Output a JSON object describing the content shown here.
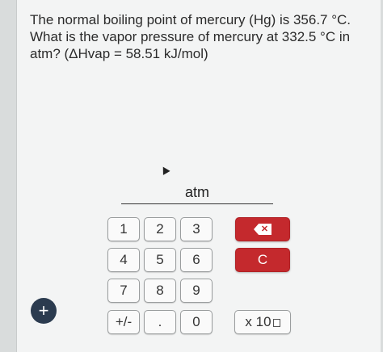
{
  "question": {
    "text": "The normal boiling point of mercury (Hg) is 356.7 °C. What is the vapor pressure of mercury at 332.5 °C in atm? (ΔHvap = 58.51 kJ/mol)"
  },
  "answer": {
    "unit": "atm"
  },
  "keypad": {
    "digits": [
      "1",
      "2",
      "3",
      "4",
      "5",
      "6",
      "7",
      "8",
      "9",
      "0"
    ],
    "sign_label": "+/-",
    "decimal_label": ".",
    "sci_label": "x 10",
    "clear_label": "C",
    "backspace_icon": "backspace-icon",
    "button_color": "#c4292d"
  },
  "fab": {
    "label": "+",
    "color": "#2b3b4f"
  }
}
